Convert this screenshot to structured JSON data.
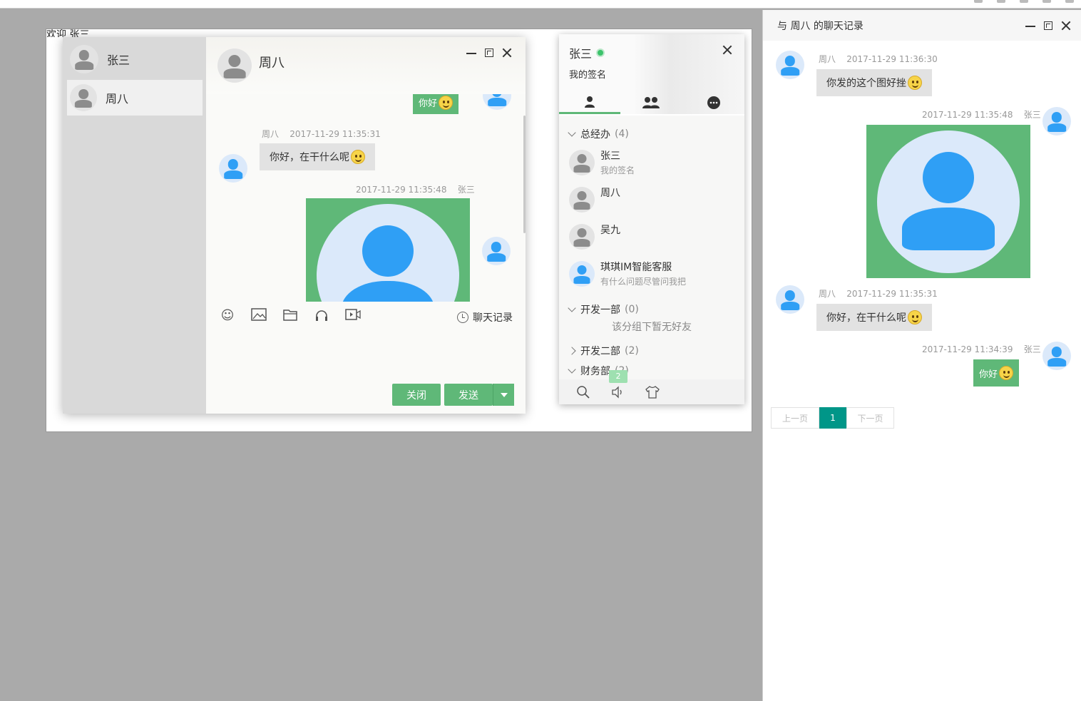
{
  "welcome": "欢迎 张三",
  "chat_window": {
    "sidebar": [
      {
        "name": "张三",
        "active": false
      },
      {
        "name": "周八",
        "active": true
      }
    ],
    "title": "周八",
    "messages": {
      "m1_text": "你好",
      "m2_author": "周八",
      "m2_time": "2017-11-29 11:35:31",
      "m2_text": "你好，在干什么呢",
      "m3_time": "2017-11-29 11:35:48",
      "m3_author": "张三"
    },
    "toolbar_icons": [
      "emoji-icon",
      "image-icon",
      "folder-icon",
      "headphones-icon",
      "video-icon"
    ],
    "history_link": "聊天记录",
    "close_button": "关闭",
    "send_button": "发送"
  },
  "friend_panel": {
    "user_name": "张三",
    "signature": "我的签名",
    "tabs": [
      "friends-tab",
      "groups-tab",
      "chat-history-tab"
    ],
    "groups": [
      {
        "label": "总经办",
        "count": "(4)",
        "expanded": true
      },
      {
        "label": "开发一部",
        "count": "(0)",
        "expanded": true
      },
      {
        "label": "开发二部",
        "count": "(2)",
        "expanded": false
      },
      {
        "label": "财务部",
        "count": "(2)",
        "expanded": true
      }
    ],
    "friends": [
      {
        "name": "张三",
        "sign": "我的签名",
        "avatar": "gray"
      },
      {
        "name": "周八",
        "sign": "",
        "avatar": "gray"
      },
      {
        "name": "吴九",
        "sign": "",
        "avatar": "gray"
      },
      {
        "name": "琪琪IM智能客服",
        "sign": "有什么问题尽管问我把",
        "avatar": "blue"
      }
    ],
    "empty_group_note": "该分组下暂无好友",
    "badge": "2",
    "bottom_icons": [
      "search-icon",
      "speaker-icon",
      "skin-icon"
    ]
  },
  "history_panel": {
    "title": "与 周八 的聊天记录",
    "entries": {
      "e1_author": "周八",
      "e1_time": "2017-11-29 11:36:30",
      "e1_text": "你发的这个图好挫",
      "e2_time": "2017-11-29 11:35:48",
      "e2_author": "张三",
      "e3_author": "周八",
      "e3_time": "2017-11-29 11:35:31",
      "e3_text": "你好，在干什么呢",
      "e4_time": "2017-11-29 11:34:39",
      "e4_author": "张三",
      "e4_text": "你好"
    },
    "pager": {
      "prev": "上一页",
      "current": "1",
      "next": "下一页"
    }
  },
  "colors": {
    "accent_green": "#5fb878",
    "avatar_blue": "#2f9ff5",
    "pager_teal": "#009688"
  }
}
